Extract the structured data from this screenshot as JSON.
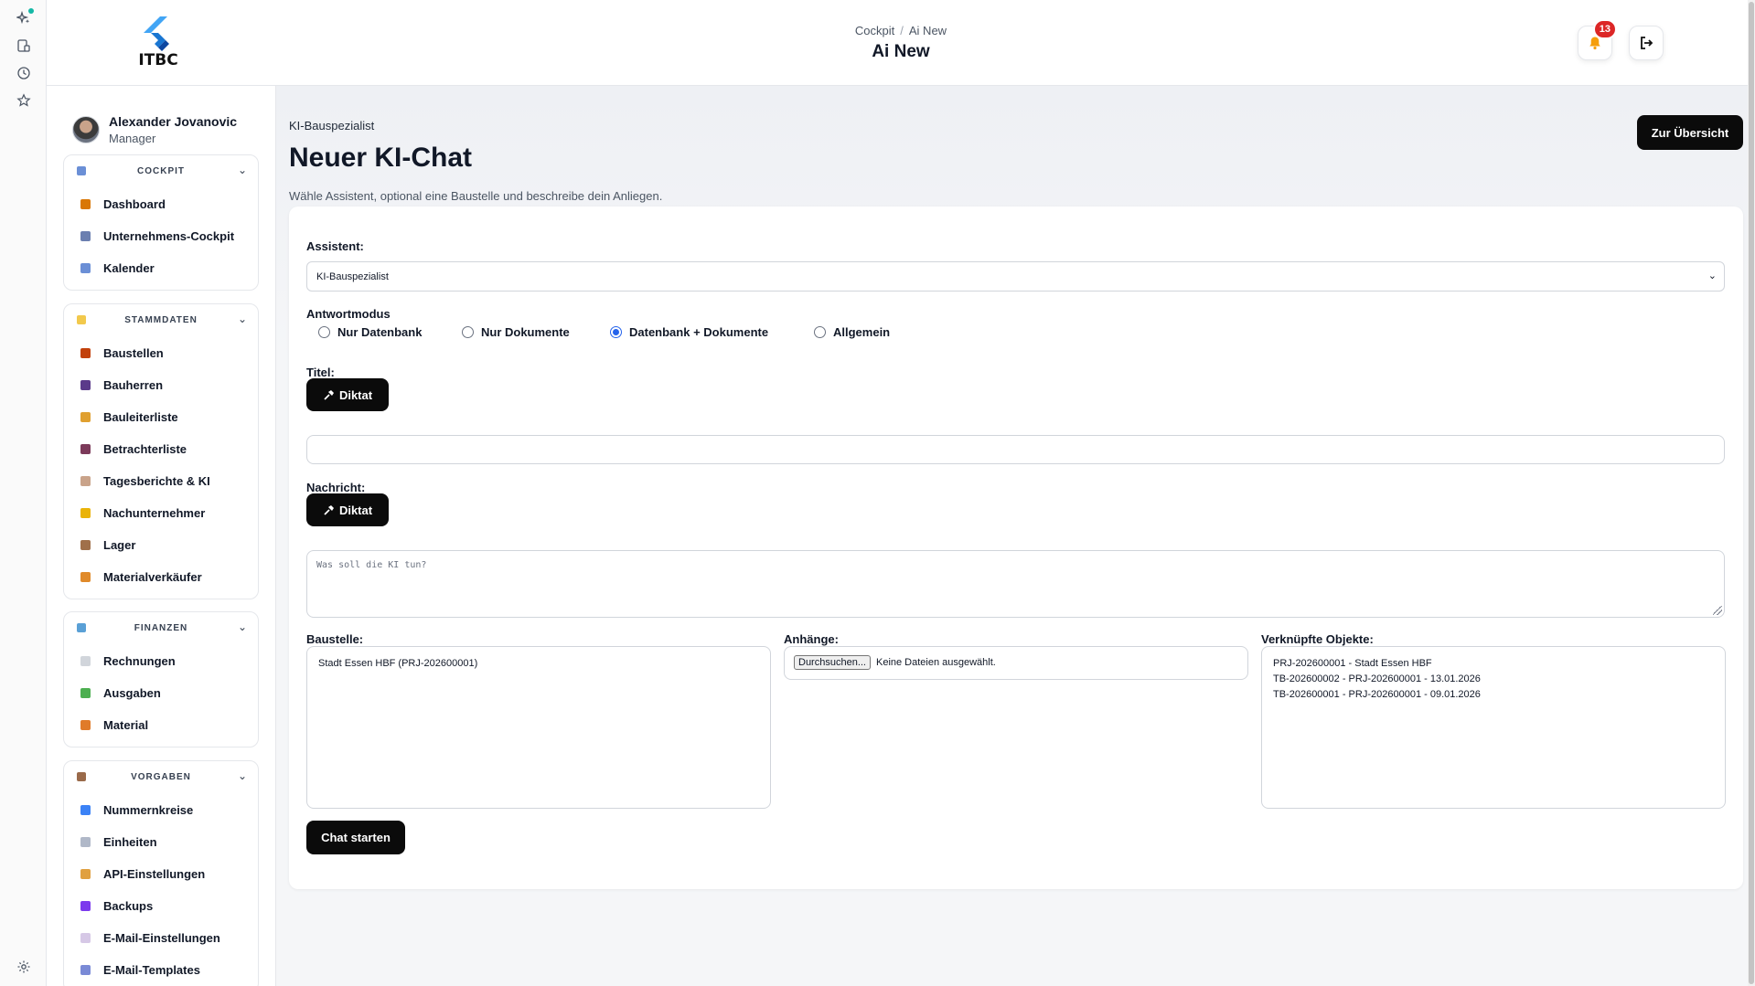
{
  "header": {
    "logo_text": "ITBC",
    "breadcrumb": [
      "Cockpit",
      "Ai New"
    ],
    "title": "Ai New",
    "notification_count": "13"
  },
  "sidebar": {
    "user": {
      "name": "Alexander Jovanovic",
      "role": "Manager"
    },
    "groups": [
      {
        "title": "COCKPIT",
        "icon_color": "#6b8fd6",
        "items": [
          {
            "label": "Dashboard",
            "icon": "house-icon",
            "color": "#d97706"
          },
          {
            "label": "Unternehmens-Cockpit",
            "icon": "building-icon",
            "color": "#6b7fb0"
          },
          {
            "label": "Kalender",
            "icon": "calendar-icon",
            "color": "#6b8fd6"
          }
        ]
      },
      {
        "title": "STAMMDATEN",
        "icon_color": "#f2c94c",
        "items": [
          {
            "label": "Baustellen",
            "icon": "bricks-icon",
            "color": "#c2410c"
          },
          {
            "label": "Bauherren",
            "icon": "person-icon",
            "color": "#5b3a8a"
          },
          {
            "label": "Bauleiterliste",
            "icon": "worker-icon",
            "color": "#e0a030"
          },
          {
            "label": "Betrachterliste",
            "icon": "eye-icon",
            "color": "#7c3a5a"
          },
          {
            "label": "Tagesberichte & KI",
            "icon": "clipboard-icon",
            "color": "#c9a38a"
          },
          {
            "label": "Nachunternehmer",
            "icon": "handshake-icon",
            "color": "#eab308"
          },
          {
            "label": "Lager",
            "icon": "box-icon",
            "color": "#a0704a"
          },
          {
            "label": "Materialverkäufer",
            "icon": "crane-icon",
            "color": "#e08a2a"
          }
        ]
      },
      {
        "title": "FINANZEN",
        "icon_color": "#5aa0d6",
        "items": [
          {
            "label": "Rechnungen",
            "icon": "receipt-icon",
            "color": "#d1d5db"
          },
          {
            "label": "Ausgaben",
            "icon": "money-icon",
            "color": "#4caf50"
          },
          {
            "label": "Material",
            "icon": "truck-icon",
            "color": "#e07b2a"
          }
        ]
      },
      {
        "title": "VORGABEN",
        "icon_color": "#9a6a4a",
        "items": [
          {
            "label": "Nummernkreise",
            "icon": "numbers-icon",
            "color": "#3b82f6"
          },
          {
            "label": "Einheiten",
            "icon": "ruler-icon",
            "color": "#b0b8c8"
          },
          {
            "label": "API-Einstellungen",
            "icon": "cookie-icon",
            "color": "#e0a040"
          },
          {
            "label": "Backups",
            "icon": "floppy-icon",
            "color": "#7c3aed"
          },
          {
            "label": "E-Mail-Einstellungen",
            "icon": "envelope-icon",
            "color": "#d6c8e6"
          },
          {
            "label": "E-Mail-Templates",
            "icon": "template-icon",
            "color": "#7a8ad6"
          }
        ]
      }
    ]
  },
  "page": {
    "subtitle": "KI-Bauspezialist",
    "title": "Neuer KI-Chat",
    "description": "Wähle Assistent, optional eine Baustelle und beschreibe dein Anliegen.",
    "overview_button": "Zur Übersicht"
  },
  "form": {
    "assistant_label": "Assistent:",
    "assistant_value": "KI-Bauspezialist",
    "mode_label": "Antwortmodus",
    "modes": [
      {
        "label": "Nur Datenbank",
        "selected": false
      },
      {
        "label": "Nur Dokumente",
        "selected": false
      },
      {
        "label": "Datenbank + Dokumente",
        "selected": true
      },
      {
        "label": "Allgemein",
        "selected": false
      }
    ],
    "title_label": "Titel:",
    "dictate_label": "Diktat",
    "title_value": "",
    "message_label": "Nachricht:",
    "message_placeholder": "Was soll die KI tun?",
    "site_label": "Baustelle:",
    "sites": [
      "Stadt Essen HBF (PRJ-202600001)"
    ],
    "attachments_label": "Anhänge:",
    "browse_label": "Durchsuchen...",
    "no_files": "Keine Dateien ausgewählt.",
    "linked_label": "Verknüpfte Objekte:",
    "linked": [
      "PRJ-202600001 - Stadt Essen HBF",
      "TB-202600002 - PRJ-202600001 - 13.01.2026",
      "TB-202600001 - PRJ-202600001 - 09.01.2026"
    ],
    "start_button": "Chat starten"
  }
}
